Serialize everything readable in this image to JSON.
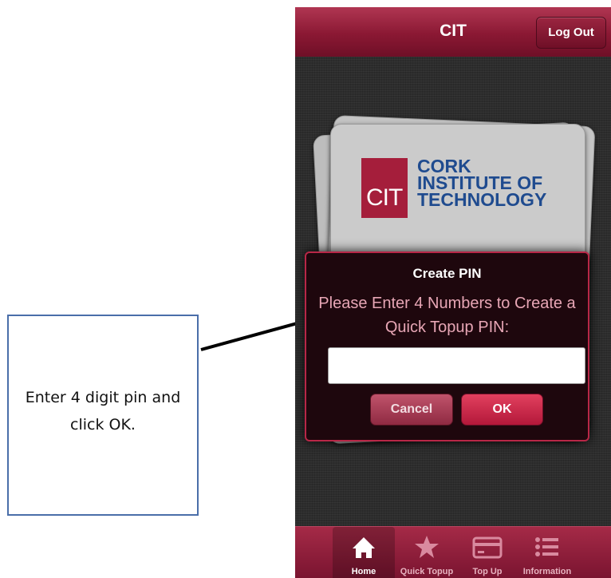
{
  "callout": {
    "text": "Enter 4 digit pin and click OK."
  },
  "header": {
    "title": "CIT",
    "logout_label": "Log Out"
  },
  "logo": {
    "mark": "CIT",
    "line1": "CORK",
    "line2": "INSTITUTE OF",
    "line3": "TECHNOLOGY"
  },
  "modal": {
    "title": "Create PIN",
    "message": "Please Enter 4 Numbers to Create a Quick Topup PIN:",
    "pin_value": "",
    "cancel_label": "Cancel",
    "ok_label": "OK"
  },
  "tabs": [
    {
      "label": "Home",
      "icon": "home-icon",
      "active": true
    },
    {
      "label": "Quick Topup",
      "icon": "star-icon",
      "active": false
    },
    {
      "label": "Top Up",
      "icon": "card-icon",
      "active": false
    },
    {
      "label": "Information",
      "icon": "list-icon",
      "active": false
    }
  ],
  "colors": {
    "brand": "#8a1833",
    "accent": "#b82747",
    "logo_blue": "#1f4b8f"
  }
}
